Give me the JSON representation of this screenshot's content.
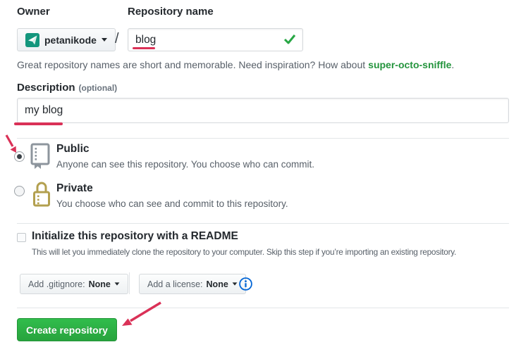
{
  "colors": {
    "avatar_teal": "#13967d",
    "check_green": "#28a745",
    "suggestion_green": "#24943d",
    "annotation_red": "#da3157",
    "button_green_top": "#31bd4c",
    "button_green_bottom": "#28a33d",
    "info_blue": "#0366d6",
    "lock_gold": "#b3a04f",
    "repo_icon_gray": "#8d959d"
  },
  "owner_field": {
    "label": "Owner",
    "value": "petanikode",
    "avatar_icon": "petanikode-logo",
    "caret_icon": "chevron-down"
  },
  "separator": "/",
  "repo_name_field": {
    "label": "Repository name",
    "value": "blog",
    "valid_icon": "green-check"
  },
  "hint": {
    "text_before": "Great repository names are short and memorable. Need inspiration? How about",
    "suggestion": "super-octo-sniffle",
    "text_after": "."
  },
  "description_field": {
    "label": "Description",
    "optional_note": "(optional)",
    "value": "my blog"
  },
  "visibility": {
    "options": [
      {
        "id": "public",
        "label": "Public",
        "description": "Anyone can see this repository. You choose who can commit.",
        "icon": "repo-book",
        "selected": true
      },
      {
        "id": "private",
        "label": "Private",
        "description": "You choose who can see and commit to this repository.",
        "icon": "lock",
        "selected": false
      }
    ]
  },
  "readme_option": {
    "label": "Initialize this repository with a README",
    "note": "This will let you immediately clone the repository to your computer. Skip this step if you’re importing an existing repository.",
    "checked": false
  },
  "file_menus": {
    "gitignore": {
      "label": "Add .gitignore:",
      "value": "None",
      "caret_icon": "chevron-down"
    },
    "license": {
      "label": "Add a license:",
      "value": "None",
      "caret_icon": "chevron-down"
    },
    "info_icon": "info-circle"
  },
  "submit": {
    "label": "Create repository"
  },
  "annotations": {
    "arrow_to_public_radio": "red-arrow",
    "arrow_to_create_button": "red-arrow",
    "underline_blog": "red-underline",
    "underline_my_blog": "red-underline"
  }
}
